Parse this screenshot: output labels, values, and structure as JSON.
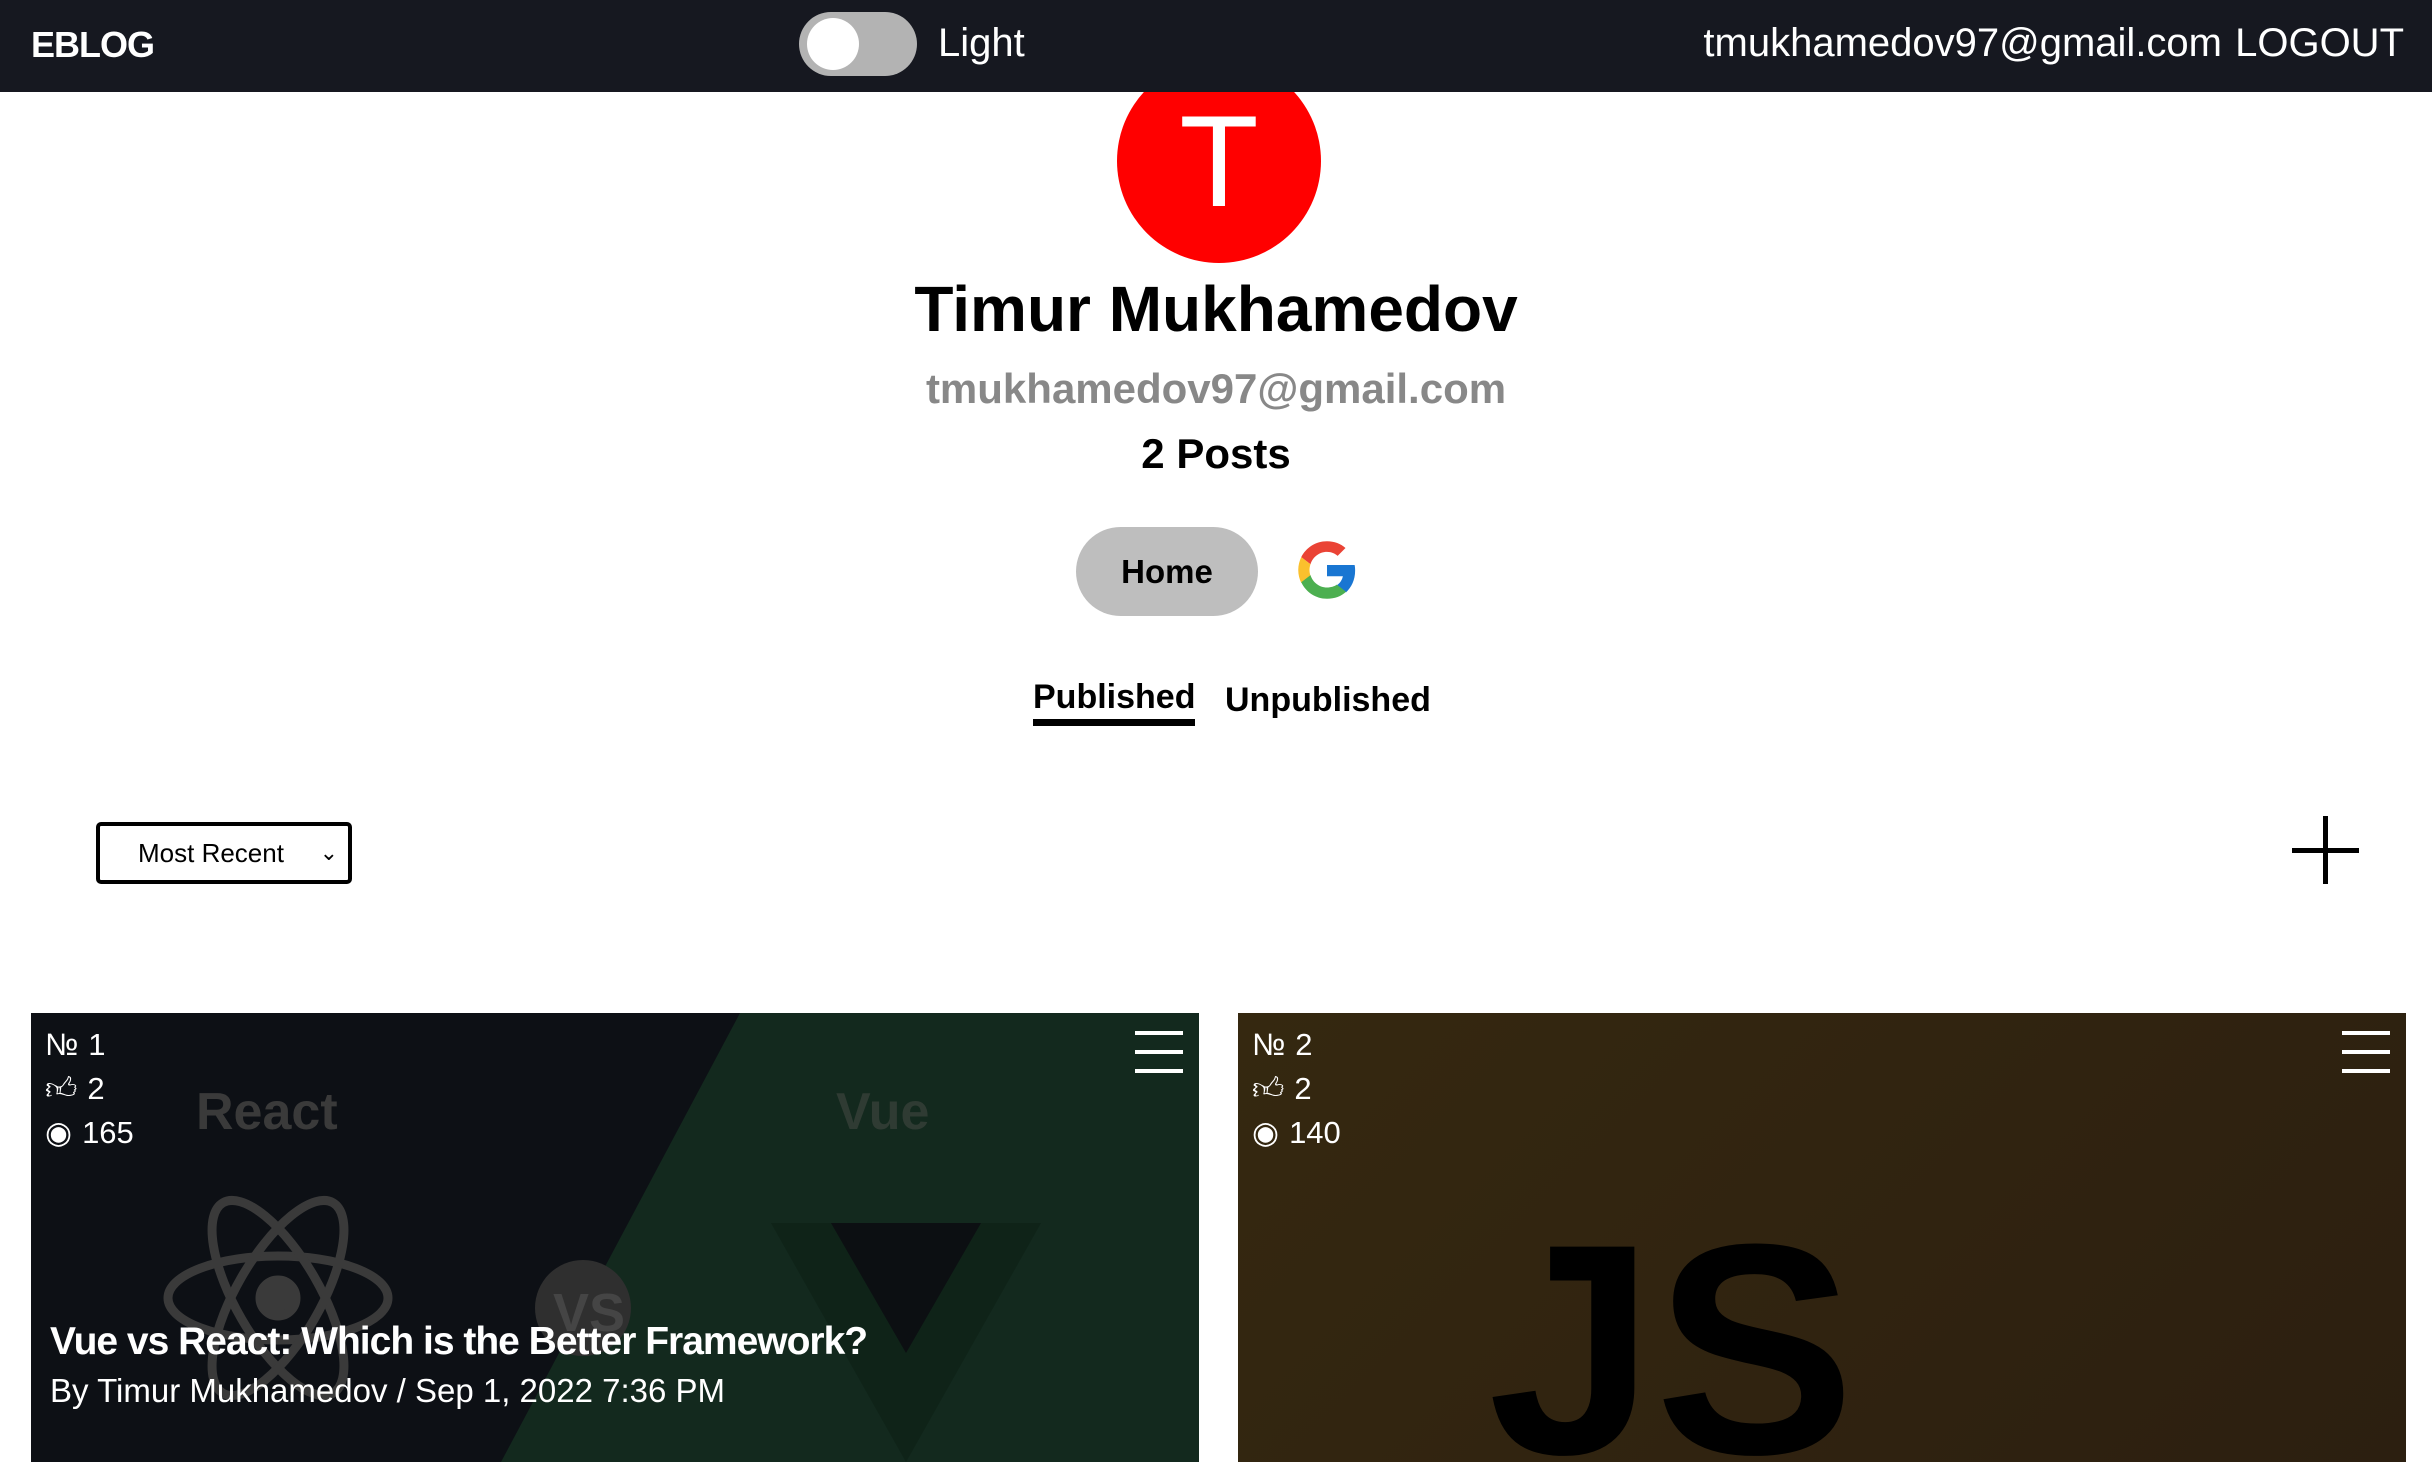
{
  "nav": {
    "logo": "EBLOG",
    "theme_label": "Light",
    "email": "tmukhamedov97@gmail.com",
    "logout": "LOGOUT"
  },
  "profile": {
    "initial": "T",
    "name": "Timur Mukhamedov",
    "email": "tmukhamedov97@gmail.com",
    "posts": "2 Posts",
    "avatar_color": "#ff0000"
  },
  "links": {
    "home": "Home"
  },
  "tabs": [
    {
      "label": "Published"
    },
    {
      "label": "Unpublished"
    }
  ],
  "sort": {
    "selected": "Most Recent"
  },
  "cards": [
    {
      "number": "1",
      "likes": "2",
      "views": "165",
      "image_text_left": "React",
      "image_text_right": "Vue",
      "image_vs": "VS",
      "title": "Vue vs React: Which is the Better Framework?",
      "byline": "By Timur Mukhamedov / Sep 1, 2022 7:36 PM"
    },
    {
      "number": "2",
      "likes": "2",
      "views": "140",
      "image_text": "JS"
    }
  ]
}
